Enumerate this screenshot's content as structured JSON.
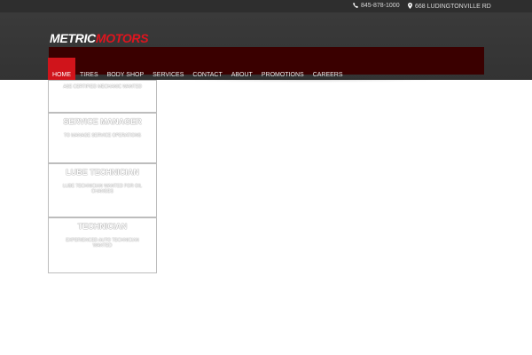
{
  "topbar": {
    "phone": "845-878-1000",
    "address": "668 LUDINGTONVILLE RD",
    "phone_icon": "phone-icon",
    "address_icon": "map-marker-icon"
  },
  "logo": {
    "part1": "METRIC",
    "part2": "MOTORS"
  },
  "nav": [
    {
      "label": "HOME",
      "active": true
    },
    {
      "label": "TIRES",
      "active": false
    },
    {
      "label": "BODY SHOP",
      "active": false
    },
    {
      "label": "SERVICES",
      "active": false
    },
    {
      "label": "CONTACT",
      "active": false
    },
    {
      "label": "ABOUT",
      "active": false
    },
    {
      "label": "PROMOTIONS",
      "active": false
    },
    {
      "label": "CAREERS",
      "active": false
    }
  ],
  "jobs": [
    {
      "title": "",
      "desc": "ASE CERTIFIED MECHANIC WANTED"
    },
    {
      "title": "SERVICE MANAGER",
      "desc": "TO MANAGE SERVICE OPERATIONS"
    },
    {
      "title": "LUBE TECHNICIAN",
      "desc": "LUBE TECHNICIAN WANTED FOR OIL CHANGES"
    },
    {
      "title": "TECHNICIAN",
      "desc": "EXPERIENCED AUTO TECHNICIAN WANTED"
    }
  ],
  "colors": {
    "accent": "#d0141b",
    "logo_red": "#e0141e",
    "banner": "#3a0000",
    "header": "#363636"
  }
}
